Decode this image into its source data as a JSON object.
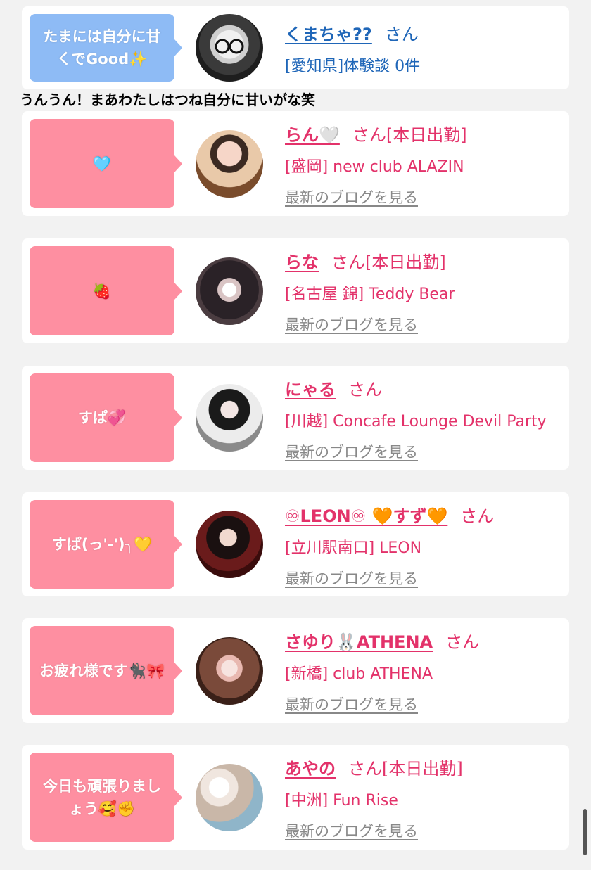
{
  "first_comment": {
    "bubble": "たまには自分に甘くでGood✨",
    "name": "くまちゃ??",
    "honorific": "さん",
    "shop": "[愛知県]体験談 0件"
  },
  "reply_text": "うんうん！まあわたしはつね自分に甘いがな笑",
  "comments": [
    {
      "bubble": "🩵",
      "name": "らん🤍",
      "honorific": "さん",
      "status": "[本日出勤]",
      "shop": "[盛岡] new club ALAZIN",
      "blog": "最新のブログを見る"
    },
    {
      "bubble": "🍓",
      "name": "らな",
      "honorific": "さん",
      "status": "[本日出勤]",
      "shop": "[名古屋 錦] Teddy Bear",
      "blog": "最新のブログを見る"
    },
    {
      "bubble": "すぱ💞",
      "name": "にゃる",
      "honorific": "さん",
      "status": "",
      "shop": "[川越] Concafe Lounge Devil Party",
      "blog": "最新のブログを見る"
    },
    {
      "bubble": "すぱ(っ'-')╮💛",
      "name": "♾LEON♾ 🧡すず🧡",
      "honorific": "さん",
      "status": "",
      "shop": "[立川駅南口] LEON",
      "blog": "最新のブログを見る"
    },
    {
      "bubble": "お疲れ様です🐈‍⬛🎀",
      "name": "さゆり🐰ATHENA",
      "honorific": "さん",
      "status": "",
      "shop": "[新橋] club ATHENA",
      "blog": "最新のブログを見る"
    },
    {
      "bubble": "今日も頑張りましょう🥰✊",
      "name": "あやの",
      "honorific": "さん",
      "status": "[本日出勤]",
      "shop": "[中洲] Fun Rise",
      "blog": "最新のブログを見る"
    }
  ],
  "colors": {
    "page_bg": "#f2f2f2",
    "blue_bubble": "#8ebbf5",
    "pink_bubble": "#fe8fa1",
    "pink_text": "#e3326a",
    "blue_text": "#1f66b8",
    "blog_link": "#888888"
  }
}
